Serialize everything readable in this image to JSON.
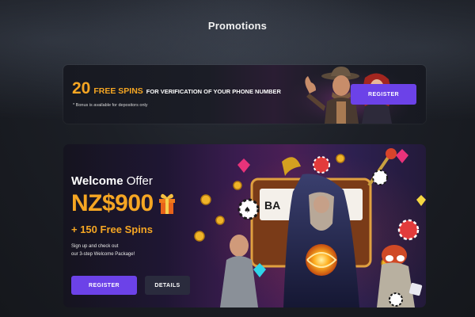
{
  "page": {
    "title": "Promotions"
  },
  "banner_verification": {
    "number": "20",
    "free_spins": "FREE SPINS",
    "rest": "FOR VERIFICATION  OF YOUR PHONE NUMBER",
    "note": "* Bonus is available for depositors only",
    "register_label": "REGISTER"
  },
  "banner_welcome": {
    "title_bold": "Welcome",
    "title_rest": " Offer",
    "amount": "NZ$900",
    "spins": "+ 150 Free Spins",
    "desc_line1": "Sign up and check out",
    "desc_line2": "our 3-step Welcome Package!",
    "register_label": "REGISTER",
    "details_label": "DETAILS"
  },
  "colors": {
    "accent": "#6c42e8",
    "highlight": "#f5a623",
    "background": "#1c1f26"
  },
  "icons": [
    "gift-icon",
    "card-suit-icon",
    "coin-icon",
    "gem-icon",
    "slot-machine-icon"
  ]
}
